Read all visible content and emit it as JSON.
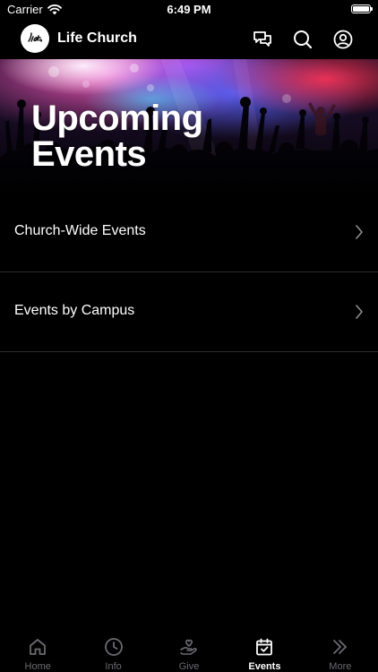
{
  "status_bar": {
    "carrier": "Carrier",
    "time": "6:49 PM",
    "battery_level": 1.0
  },
  "header": {
    "title": "Life Church",
    "logo_text": "life",
    "icons": [
      "chat-icon",
      "search-icon",
      "profile-icon"
    ]
  },
  "hero": {
    "title": "Upcoming Events"
  },
  "menu": {
    "items": [
      {
        "label": "Church-Wide Events"
      },
      {
        "label": "Events by Campus"
      }
    ]
  },
  "tabs": [
    {
      "label": "Home",
      "icon": "home-icon",
      "active": false
    },
    {
      "label": "Info",
      "icon": "clock-icon",
      "active": false
    },
    {
      "label": "Give",
      "icon": "give-icon",
      "active": false
    },
    {
      "label": "Events",
      "icon": "calendar-check-icon",
      "active": true
    },
    {
      "label": "More",
      "icon": "double-chevron-icon",
      "active": false
    }
  ],
  "colors": {
    "background": "#000000",
    "divider": "#2c2c2e",
    "tab_inactive": "#6b6b70",
    "tab_active": "#ffffff"
  }
}
